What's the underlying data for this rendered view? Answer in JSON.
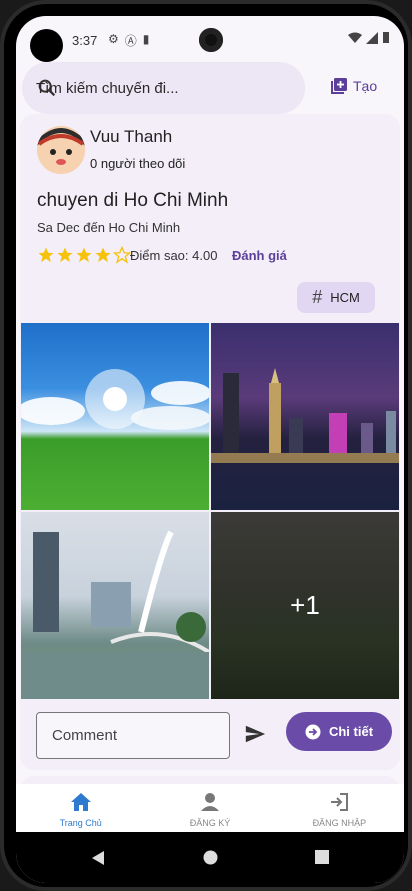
{
  "status_bar": {
    "time": "3:37"
  },
  "search": {
    "placeholder": "Tìm kiếm chuyến đi..."
  },
  "header": {
    "create_label": "Tạo"
  },
  "post": {
    "user_name": "Vuu Thanh",
    "followers": "0 người theo dõi",
    "title": "chuyen di Ho Chi Minh",
    "route": "Sa Dec đến Ho Chi Minh",
    "rating": 4.0,
    "rating_label": "Điểm sao: 4.00",
    "rate_link": "Đánh giá",
    "tag": "HCM",
    "more_photos": "+1",
    "comment_placeholder": "Comment",
    "detail_button": "Chi tiết"
  },
  "bottom_nav": {
    "items": [
      {
        "label": "Trang Chủ",
        "icon": "home-icon",
        "active": true
      },
      {
        "label": "ĐĂNG KÝ",
        "icon": "person-icon",
        "active": false
      },
      {
        "label": "ĐĂNG NHẬP",
        "icon": "login-icon",
        "active": false
      }
    ]
  },
  "colors": {
    "accent": "#6a4ca8",
    "nav_active": "#2f7ad1",
    "star": "#f6c20c"
  }
}
